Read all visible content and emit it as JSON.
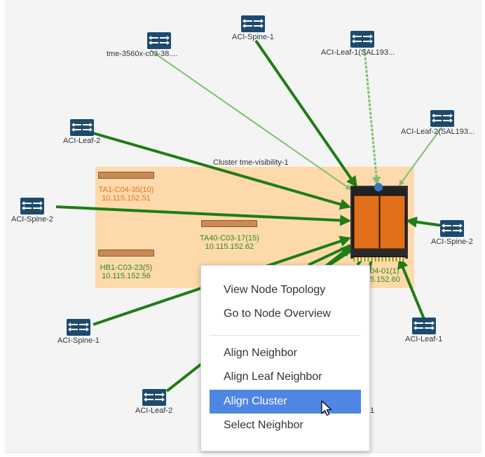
{
  "cluster": {
    "title": "Cluster tme-visibility-1"
  },
  "nodes": {
    "tme_3560": "tme-3560x-c03-38....",
    "spine_top": "ACI-Spine-1",
    "leaf1_sal": "ACI-Leaf-1(SAL193...",
    "leaf2_sal": "ACI-Leaf-2(SAL193...",
    "leaf2_left": "ACI-Leaf-2",
    "spine2_left": "ACI-Spine-2",
    "spine2_right": "ACI-Spine-2",
    "spine1_bottom": "ACI-Spine-1",
    "leaf1_right": "ACI-Leaf-1",
    "leaf2_bottom": "ACI-Leaf-2"
  },
  "members": {
    "ta1": {
      "name": "TA1-C04-35(10)",
      "ip": "10.115.152.51"
    },
    "ta40": {
      "name": "TA40-C03-17(15)",
      "ip": "10.115.152.62"
    },
    "hb1": {
      "name": "HB1-C03-23(5)",
      "ip": "10.115.152.56"
    },
    "chassis": {
      "name": "04-01(1)",
      "ip": "5.152.60"
    }
  },
  "context_menu": {
    "items": [
      {
        "label": "View Node Topology"
      },
      {
        "label": "Go to Node Overview"
      },
      {
        "label": "Align Neighbor"
      },
      {
        "label": "Align Leaf Neighbor"
      },
      {
        "label": "Align Cluster",
        "active": true
      },
      {
        "label": "Select Neighbor"
      }
    ]
  },
  "partial_labels": {
    "behind_menu": "1"
  },
  "colors": {
    "edge": "#1e7d14",
    "edge_light": "#7cc16f",
    "cluster_bg": "#fdd9ab",
    "menu_active": "#4f86e3",
    "switch_icon": "#1d4a6e"
  },
  "icons": {
    "switch": "switch-icon",
    "cursor": "mouse-pointer-icon"
  }
}
